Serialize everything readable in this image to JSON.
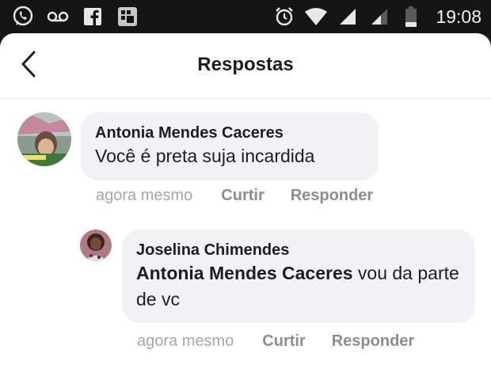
{
  "status_bar": {
    "time": "19:08",
    "icons": [
      "whatsapp-icon",
      "voicemail-icon",
      "facebook-icon",
      "gallery-icon",
      "alarm-icon",
      "wifi-icon",
      "signal-icon",
      "signal-icon",
      "battery-icon"
    ]
  },
  "header": {
    "title": "Respostas",
    "back_icon": "chevron-left-icon"
  },
  "comments": [
    {
      "author": "Antonia Mendes Caceres",
      "text": "Você é preta suja incardida",
      "time": "agora mesmo",
      "like_label": "Curtir",
      "reply_label": "Responder"
    },
    {
      "author": "Joselina Chimendes",
      "mention": "Antonia Mendes Caceres",
      "text": " vou da parte de vc",
      "time": "agora mesmo",
      "like_label": "Curtir",
      "reply_label": "Responder"
    }
  ],
  "colors": {
    "bubble": "#f0f2f5",
    "text": "#1c1e21",
    "meta": "#8a8d91",
    "status_bar": "#151515"
  }
}
